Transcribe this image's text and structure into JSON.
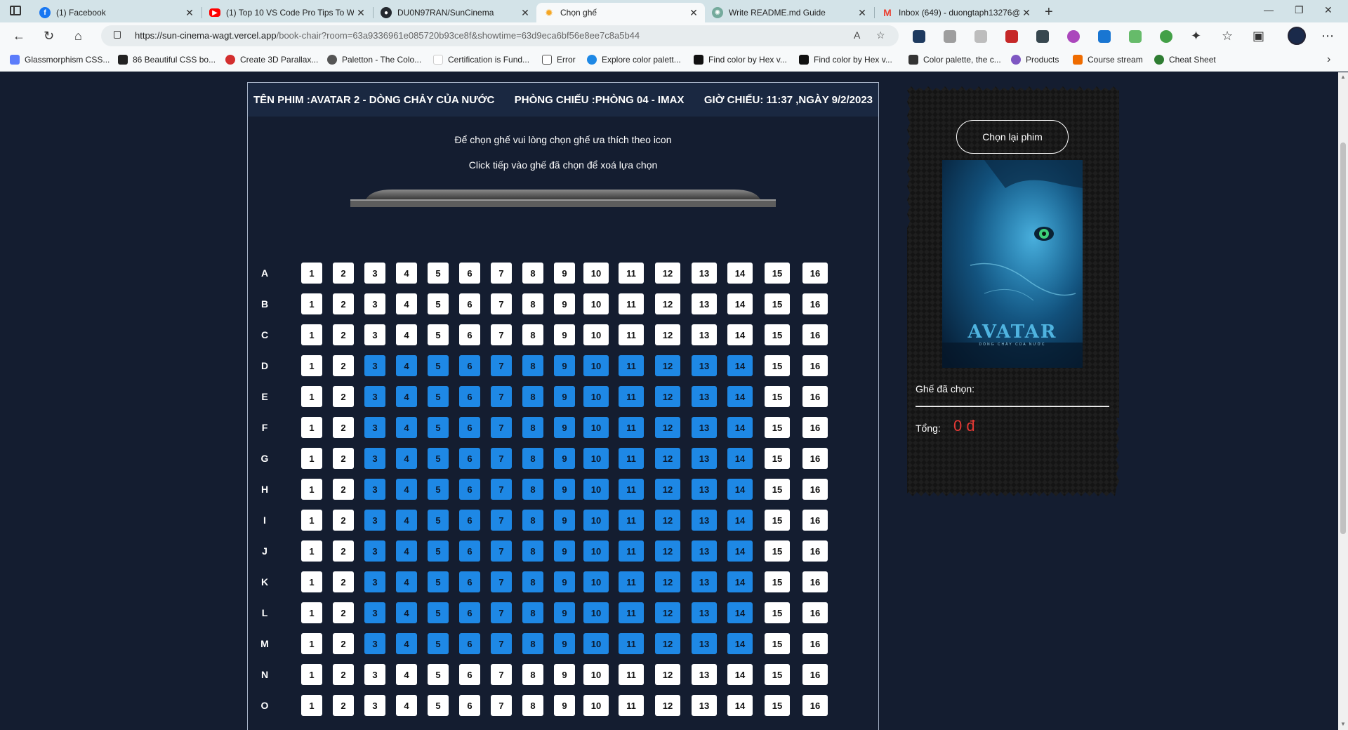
{
  "browser": {
    "tabs": [
      {
        "title": "(1) Facebook",
        "icon": "facebook-icon",
        "color": "#1877f2"
      },
      {
        "title": "(1) Top 10 VS Code Pro Tips To W",
        "icon": "youtube-icon",
        "color": "#ff0000"
      },
      {
        "title": "DU0N97RAN/SunCinema",
        "icon": "github-icon",
        "color": "#24292f"
      },
      {
        "title": "Chọn ghế",
        "icon": "sun-icon",
        "color": "#f5a623"
      },
      {
        "title": "Write README.md Guide",
        "icon": "openai-icon",
        "color": "#74aa9c"
      },
      {
        "title": "Inbox (649) - duongtaph13276@",
        "icon": "gmail-icon",
        "color": "#ea4335"
      }
    ],
    "url_host": "https://sun-cinema-wagt.vercel.app",
    "url_path": "/book-chair?room=63a9336961e085720b93ce8f&showtime=63d9eca6bf56e8ee7c8a5b44",
    "bookmarks": [
      {
        "label": "Glassmorphism CSS...",
        "color": "#5b7cfa"
      },
      {
        "label": "86 Beautiful CSS bo...",
        "color": "#222222"
      },
      {
        "label": "Create 3D Parallax...",
        "color": "#d32f2f"
      },
      {
        "label": "Paletton - The Colo...",
        "color": "#555555"
      },
      {
        "label": "Certification is Fund...",
        "color": "#ffffff"
      },
      {
        "label": "Error",
        "color": "#ffffff"
      },
      {
        "label": "Explore color palett...",
        "color": "#1e88e5"
      },
      {
        "label": "Find color by Hex v...",
        "color": "#111111"
      },
      {
        "label": "Find color by Hex v...",
        "color": "#111111"
      },
      {
        "label": "Color palette, the c...",
        "color": "#333333"
      },
      {
        "label": "Products",
        "color": "#7e57c2"
      },
      {
        "label": "Course stream",
        "color": "#ef6c00"
      },
      {
        "label": "Cheat Sheet",
        "color": "#2e7d32"
      }
    ]
  },
  "movie": {
    "title_text": "TÊN PHIM :AVATAR 2 - DÒNG CHẢY CỦA NƯỚC",
    "room_text": "PHÒNG CHIẾU :PHÒNG 04 - IMAX",
    "time_text": "GIỜ CHIẾU: 11:37 ,NGÀY 9/2/2023"
  },
  "instructions": {
    "line1": "Để chọn ghế vui lòng chọn ghế ưa thích theo icon",
    "line2": "Click tiếp vào ghế đã chọn để xoá lựa chọn"
  },
  "seating": {
    "rows": [
      "A",
      "B",
      "C",
      "D",
      "E",
      "F",
      "G",
      "H",
      "I",
      "J",
      "K",
      "L",
      "M",
      "N",
      "O"
    ],
    "seat_numbers": [
      1,
      2,
      3,
      4,
      5,
      6,
      7,
      8,
      9,
      10,
      11,
      12,
      13,
      14,
      15,
      16
    ],
    "vip_rows": [
      "D",
      "E",
      "F",
      "G",
      "H",
      "I",
      "J",
      "K",
      "L",
      "M"
    ],
    "vip_seat_range": [
      3,
      14
    ],
    "standard_color": "#ffffff",
    "vip_color": "#1e88e5"
  },
  "ticket": {
    "reselect_label": "Chọn lại phim",
    "poster_title": "AVATAR",
    "poster_sub": "DÒNG CHẢY CỦA NƯỚC",
    "chosen_label": "Ghế đã chọn:",
    "total_label": "Tổng:",
    "total_value": "0 đ",
    "total_color": "#e53935"
  }
}
